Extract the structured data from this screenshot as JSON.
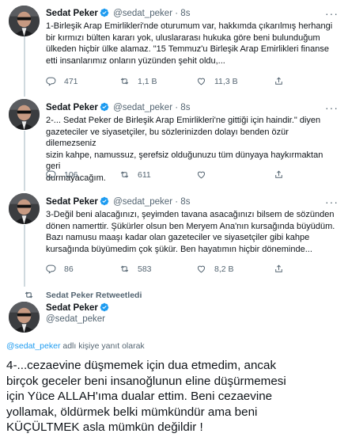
{
  "colors": {
    "text": "#0f1419",
    "muted": "#536471",
    "link": "#1d9bf0",
    "line": "#cfd9de"
  },
  "tweets": [
    {
      "name": "Sedat Peker",
      "handle": "@sedat_peker",
      "dot": "·",
      "time": "8s",
      "text": "1-Birleşik Arap Emirlikleri'nde oturumum var, hakkımda çıkarılmış herhangi\nbir kırmızı bülten kararı yok, uluslararası hukuka göre beni bulunduğum\nülkeden hiçbir ülke alamaz. \"15 Temmuz'u Birleşik Arap Emirlikleri finanse\netti insanlarımız onların yüzünden şehit oldu,...",
      "replies": "471",
      "retweets": "1,1 B",
      "likes": "11,3 B"
    },
    {
      "name": "Sedat Peker",
      "handle": "@sedat_peker",
      "dot": "·",
      "time": "8s",
      "text": "2-... Sedat Peker de Birleşik Arap Emirlikleri'ne gittiği için haindir.\" diyen\ngazeteciler ve siyasetçiler, bu sözlerinizden dolayı benden özür dilemezseniz\nsizin kahpe, namussuz, şerefsiz olduğunuzu tüm dünyaya haykırmaktan geri\ndurmayacağım.",
      "replies": "106",
      "retweets": "611",
      "likes": ""
    },
    {
      "name": "Sedat Peker",
      "handle": "@sedat_peker",
      "dot": "·",
      "time": "8s",
      "text": "3-Değil beni alacağınızı, şeyimden tavana asacağınızı bilsem de sözünden\ndönen namerttir. Şükürler olsun ben Meryem Ana'nın kursağında büyüdüm.\nBazı namusu maaşı kadar olan gazeteciler ve siyasetçiler gibi kahpe\nkursağında büyümedim çok şükür. Ben hayatımın hiçbir döneminde...",
      "replies": "86",
      "retweets": "583",
      "likes": "8,2 B"
    }
  ],
  "main": {
    "retweeted_by": "Sedat Peker Retweetledi",
    "name": "Sedat Peker",
    "handle": "@sedat_peker",
    "reply_handle": "@sedat_peker",
    "reply_suffix": " adlı kişiye yanıt olarak",
    "text": "4-...cezaevine düşmemek için dua etmedim, ancak\nbirçok geceler beni insanoğlunun eline düşürmemesi\niçin Yüce ALLAH'ıma dualar ettim. Beni cezaevine\nyollamak, öldürmek belki mümkündür ama beni\nKÜÇÜLTMEK asla mümkün değildir !"
  }
}
